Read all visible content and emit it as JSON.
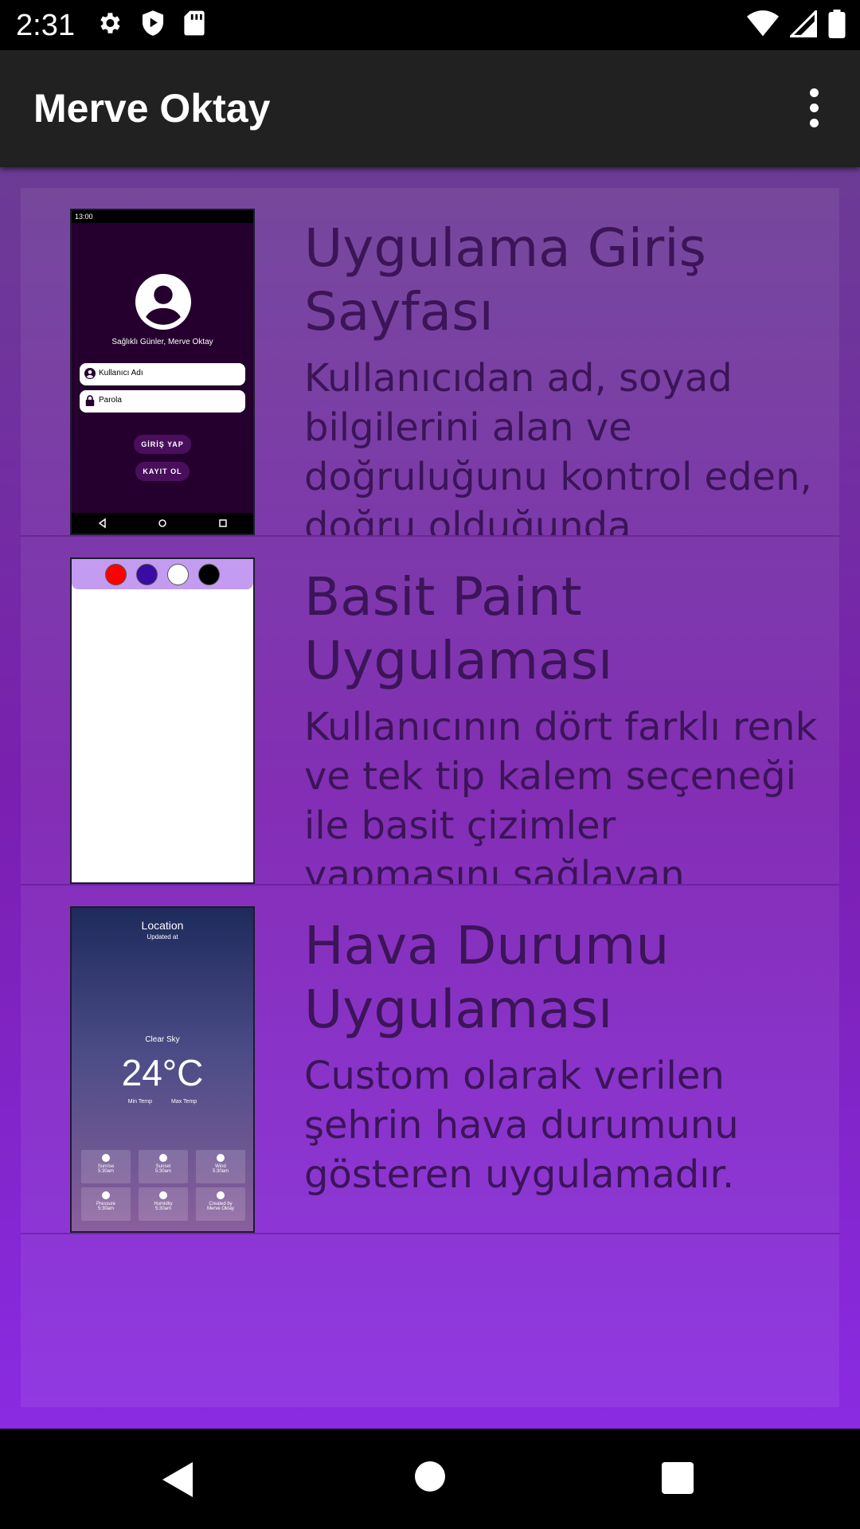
{
  "status_bar": {
    "time": "2:31",
    "left_icons": [
      "settings-icon",
      "play-protect-icon",
      "sd-card-icon"
    ],
    "right_icons": [
      "wifi-icon",
      "signal-icon",
      "battery-icon"
    ]
  },
  "app_bar": {
    "title": "Merve Oktay",
    "menu_icon": "more-vert-icon"
  },
  "projects": [
    {
      "title": "Uygulama Giriş Sayfası",
      "description": "Kullanıcıdan ad, soyad bilgilerini alan ve doğruluğunu kontrol eden, doğru olduğunda",
      "thumbnail": {
        "time": "13:00",
        "greeting": "Sağlıklı Günler, Merve Oktay",
        "username_placeholder": "Kullanıcı Adı",
        "password_placeholder": "Parola",
        "login_label": "GİRİŞ YAP",
        "register_label": "KAYIT OL"
      }
    },
    {
      "title": "Basit Paint Uygulaması",
      "description": "Kullanıcının dört farklı renk ve tek tip kalem seçeneği ile basit çizimler yapmasını sağlayan uygulamadır.",
      "thumbnail": {
        "colors": [
          "#ff0000",
          "#3a0ca3",
          "#ffffff",
          "#000000"
        ]
      }
    },
    {
      "title": "Hava Durumu Uygulaması",
      "description": "Custom olarak verilen şehrin hava durumunu gösteren uygulamadır.",
      "thumbnail": {
        "location": "Location",
        "updated": "Updated at",
        "condition": "Clear Sky",
        "temperature": "24°C",
        "min_label": "Min Temp",
        "max_label": "Max Temp",
        "cells": [
          {
            "label": "Sunrise",
            "value": "5:30am"
          },
          {
            "label": "Sunset",
            "value": "5:30am"
          },
          {
            "label": "Wind",
            "value": "5:30am"
          },
          {
            "label": "Pressure",
            "value": "5:30am"
          },
          {
            "label": "Humidity",
            "value": "5:30am"
          },
          {
            "label": "Created by",
            "value": "Merve Oktay"
          }
        ]
      }
    }
  ],
  "colors": {
    "app_bar": "#212121",
    "text": "#3c1458",
    "gradient_top": "#6b3c94",
    "gradient_bottom": "#8a2be2"
  },
  "nav_bar": {
    "icons": [
      "back-icon",
      "home-icon",
      "recents-icon"
    ]
  }
}
